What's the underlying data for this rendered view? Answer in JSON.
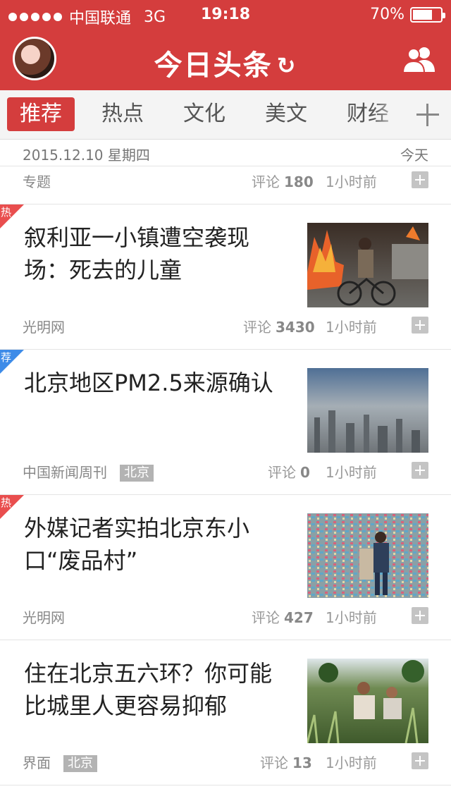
{
  "status_bar": {
    "carrier": "中国联通",
    "network": "3G",
    "time": "19:18",
    "battery_text": "70%",
    "battery_level": 0.7
  },
  "header": {
    "app_title": "今日头条",
    "refresh_icon": "refresh-icon",
    "friends_icon": "friends-icon"
  },
  "tabs": [
    {
      "label": "推荐",
      "active": true
    },
    {
      "label": "热点"
    },
    {
      "label": "文化"
    },
    {
      "label": "美文"
    },
    {
      "label": "财经"
    }
  ],
  "date_bar": {
    "date": "2015.12.10 星期四",
    "today": "今天"
  },
  "topic_row": {
    "source": "专题",
    "comments_label": "评论",
    "comments": "180",
    "time": "1小时前"
  },
  "articles": [
    {
      "badge": "热",
      "badge_color": "#e94e4e",
      "title": "叙利亚一小镇遭空袭现场：死去的儿童",
      "source": "光明网",
      "tag": "",
      "comments_label": "评论",
      "comments": "3430",
      "time": "1小时前"
    },
    {
      "badge": "荐",
      "badge_color": "#3d8be8",
      "title": "北京地区PM2.5来源确认",
      "source": "中国新闻周刊",
      "tag": "北京",
      "comments_label": "评论",
      "comments": "0",
      "time": "1小时前"
    },
    {
      "badge": "热",
      "badge_color": "#e94e4e",
      "title": "外媒记者实拍北京东小口“废品村”",
      "source": "光明网",
      "tag": "",
      "comments_label": "评论",
      "comments": "427",
      "time": "1小时前"
    },
    {
      "badge": "",
      "badge_color": "",
      "title": "住在北京五六环？你可能比城里人更容易抑郁",
      "source": "界面",
      "tag": "北京",
      "comments_label": "评论",
      "comments": "13",
      "time": "1小时前"
    }
  ],
  "colors": {
    "brand_red": "#d43d3d",
    "hot_badge": "#e94e4e",
    "recommend_badge": "#3d8be8"
  }
}
